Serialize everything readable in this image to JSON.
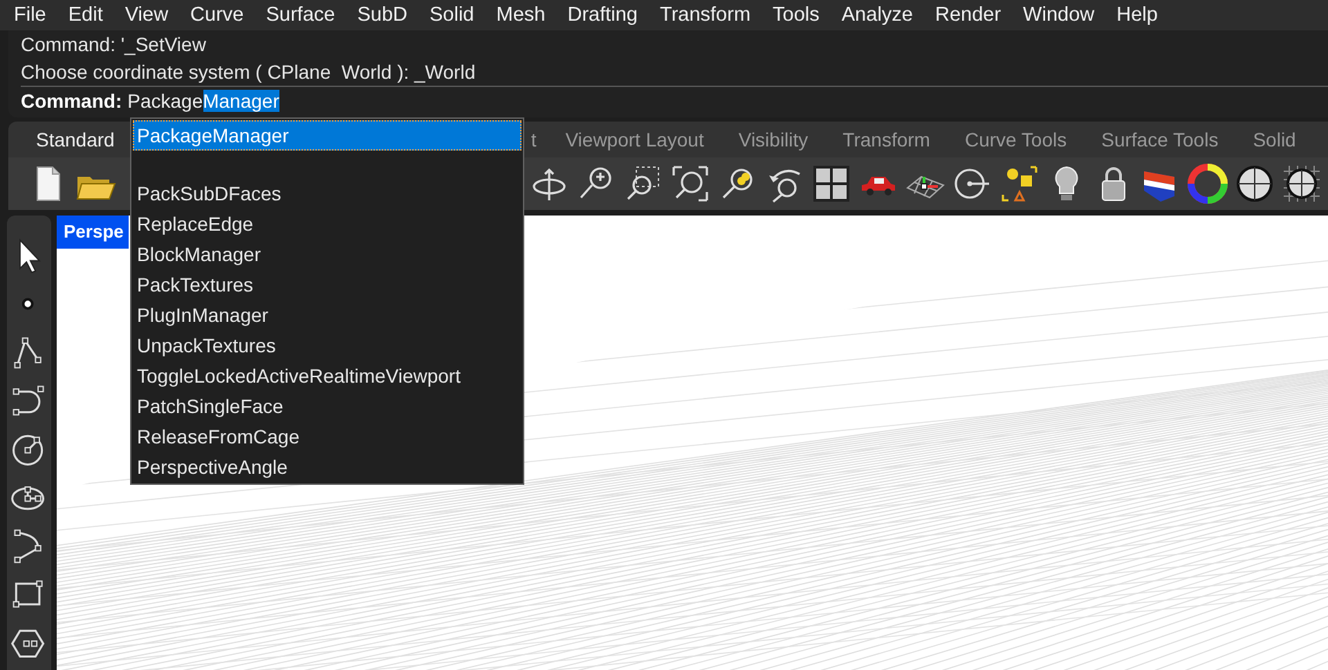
{
  "menu": [
    "File",
    "Edit",
    "View",
    "Curve",
    "Surface",
    "SubD",
    "Solid",
    "Mesh",
    "Drafting",
    "Transform",
    "Tools",
    "Analyze",
    "Render",
    "Window",
    "Help"
  ],
  "command_history": [
    "Command: '_SetView",
    "Choose coordinate system ( CPlane  World ): _World"
  ],
  "command_prompt": {
    "label": "Command:",
    "typed": "Package",
    "selected_text": "Manager"
  },
  "toolbar_tabs": [
    {
      "label": "Standard",
      "selected": true
    },
    {
      "label": "t",
      "selected": false
    },
    {
      "label": "Viewport Layout",
      "selected": false
    },
    {
      "label": "Visibility",
      "selected": false
    },
    {
      "label": "Transform",
      "selected": false
    },
    {
      "label": "Curve Tools",
      "selected": false
    },
    {
      "label": "Surface Tools",
      "selected": false
    },
    {
      "label": "Solid",
      "selected": false
    }
  ],
  "viewport": {
    "title": "Perspe",
    "active": true
  },
  "autocomplete": [
    {
      "kind": "command",
      "label": "PackageManager",
      "selected": true
    },
    {
      "kind": "blank"
    },
    {
      "kind": "command",
      "label": "PackSubDFaces",
      "selected": false
    },
    {
      "kind": "command",
      "label": "ReplaceEdge",
      "selected": false
    },
    {
      "kind": "command",
      "label": "BlockManager",
      "selected": false
    },
    {
      "kind": "command",
      "label": "PackTextures",
      "selected": false
    },
    {
      "kind": "command",
      "label": "PlugInManager",
      "selected": false
    },
    {
      "kind": "command",
      "label": "UnpackTextures",
      "selected": false
    },
    {
      "kind": "command",
      "label": "ToggleLockedActiveRealtimeViewport",
      "selected": false
    },
    {
      "kind": "command",
      "label": "PatchSingleFace",
      "selected": false
    },
    {
      "kind": "command",
      "label": "ReleaseFromCage",
      "selected": false
    },
    {
      "kind": "command",
      "label": "PerspectiveAngle",
      "selected": false
    }
  ]
}
